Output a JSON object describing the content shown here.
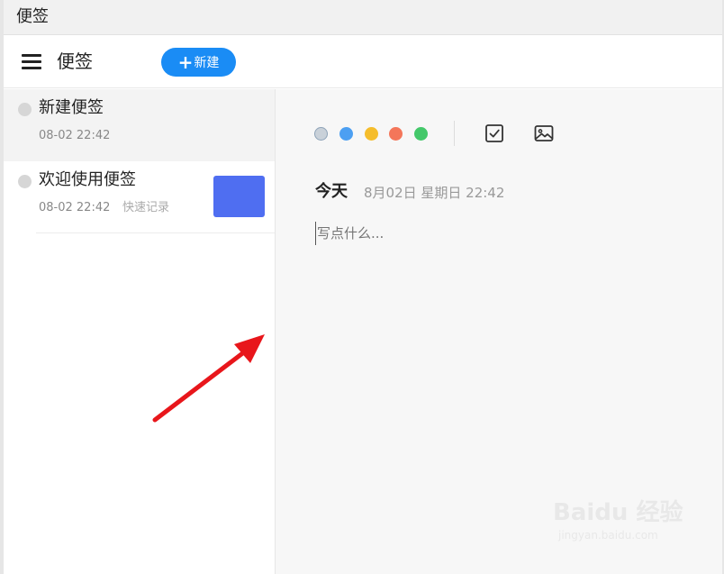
{
  "window": {
    "title": "便签"
  },
  "toolbar": {
    "app_title": "便签",
    "new_button_label": "新建",
    "menu_icon": "hamburger-menu-icon",
    "plus_icon": "+"
  },
  "sidebar": {
    "notes": [
      {
        "title": "新建便签",
        "time": "08-02 22:42",
        "tag": "",
        "active": true
      },
      {
        "title": "欢迎使用便签",
        "time": "08-02 22:42",
        "tag": "快速记录",
        "active": false,
        "thumbnail_color": "#4f6ef1"
      }
    ]
  },
  "editor": {
    "colors": [
      "#c9d1d9",
      "#4c9ff2",
      "#f5bd2c",
      "#f4765a",
      "#44c86a"
    ],
    "selected_color": 0,
    "checkbox_icon": "checkbox-icon",
    "image_icon": "image-icon",
    "date_today": "今天",
    "date_full": "8月02日 星期日 22:42",
    "placeholder": "写点什么..."
  },
  "watermark": {
    "logo": "Baidu 经验",
    "url": "jingyan.baidu.com"
  },
  "colors": {
    "accent": "#1a8cf5",
    "arrow": "#e8161b"
  }
}
